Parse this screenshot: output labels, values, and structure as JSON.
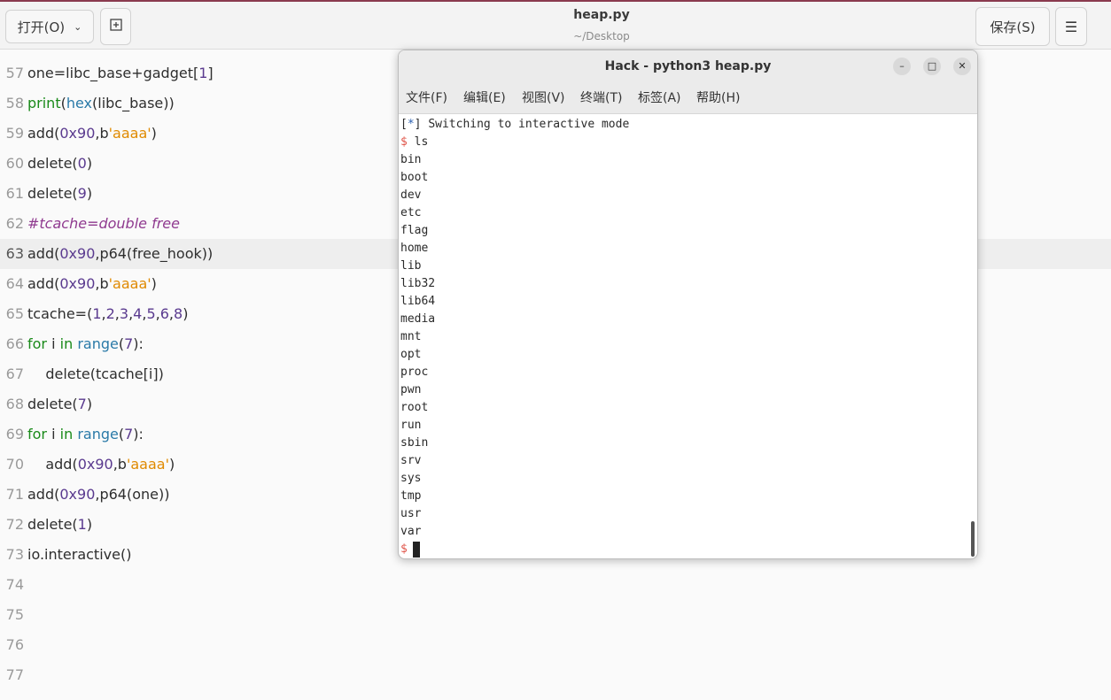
{
  "header": {
    "open_label": "打开(O)",
    "title": "heap.py",
    "subtitle": "~/Desktop",
    "save_label": "保存(S)"
  },
  "terminal": {
    "title": "Hack - python3 heap.py",
    "menu": [
      "文件(F)",
      "编辑(E)",
      "视图(V)",
      "终端(T)",
      "标签(A)",
      "帮助(H)"
    ],
    "status_line": "Switching to interactive mode",
    "status_mark": "*",
    "command": "ls",
    "prompt": "$",
    "listing": [
      "bin",
      "boot",
      "dev",
      "etc",
      "flag",
      "home",
      "lib",
      "lib32",
      "lib64",
      "media",
      "mnt",
      "opt",
      "proc",
      "pwn",
      "root",
      "run",
      "sbin",
      "srv",
      "sys",
      "tmp",
      "usr",
      "var"
    ]
  },
  "editor": {
    "current_line": 63,
    "line_numbers": [
      57,
      58,
      59,
      60,
      61,
      62,
      63,
      64,
      65,
      66,
      67,
      68,
      69,
      70,
      71,
      72,
      73,
      74,
      75,
      76,
      77
    ]
  }
}
